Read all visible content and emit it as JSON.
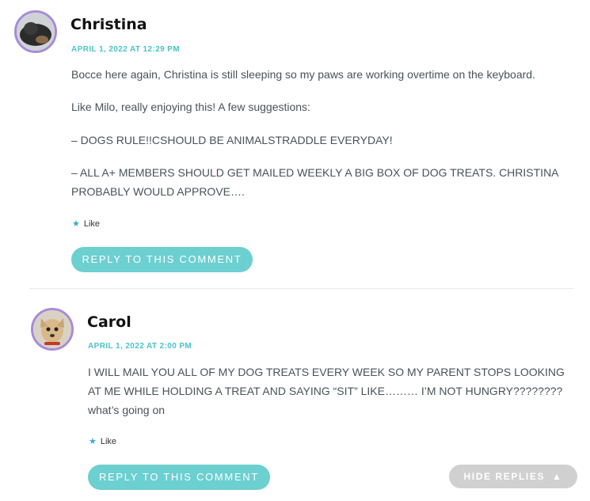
{
  "comments": [
    {
      "author": "Christina",
      "date": "APRIL 1, 2022 AT 12:29 PM",
      "paragraphs": [
        "Bocce here again, Christina is still sleeping so my paws are working overtime on the keyboard.",
        "Like Milo, really enjoying this! A few suggestions:",
        "– DOGS RULE!!CSHOULD BE ANIMALSTRADDLE EVERYDAY!",
        "– ALL A+ MEMBERS SHOULD GET MAILED WEEKLY A BIG BOX OF DOG TREATS. CHRISTINA PROBABLY WOULD APPROVE…."
      ],
      "like_label": "Like",
      "reply_label": "REPLY TO THIS COMMENT"
    },
    {
      "author": "Carol",
      "date": "APRIL 1, 2022 AT 2:00 PM",
      "paragraphs": [
        "I WILL MAIL YOU ALL OF MY DOG TREATS EVERY WEEK SO MY PARENT STOPS LOOKING AT ME WHILE HOLDING A TREAT AND SAYING “SIT” LIKE……… I’M NOT HUNGRY???????? what’s going on"
      ],
      "like_label": "Like",
      "reply_label": "REPLY TO THIS COMMENT"
    }
  ],
  "hide_replies_label": "HIDE REPLIES",
  "icons": {
    "like": "star-icon",
    "hide": "triangle-up-icon"
  },
  "colors": {
    "accent": "#4cc3c7",
    "button": "#6ccfd0",
    "avatar_border": "#a88bd8",
    "hide_button": "#d0d0d0"
  }
}
